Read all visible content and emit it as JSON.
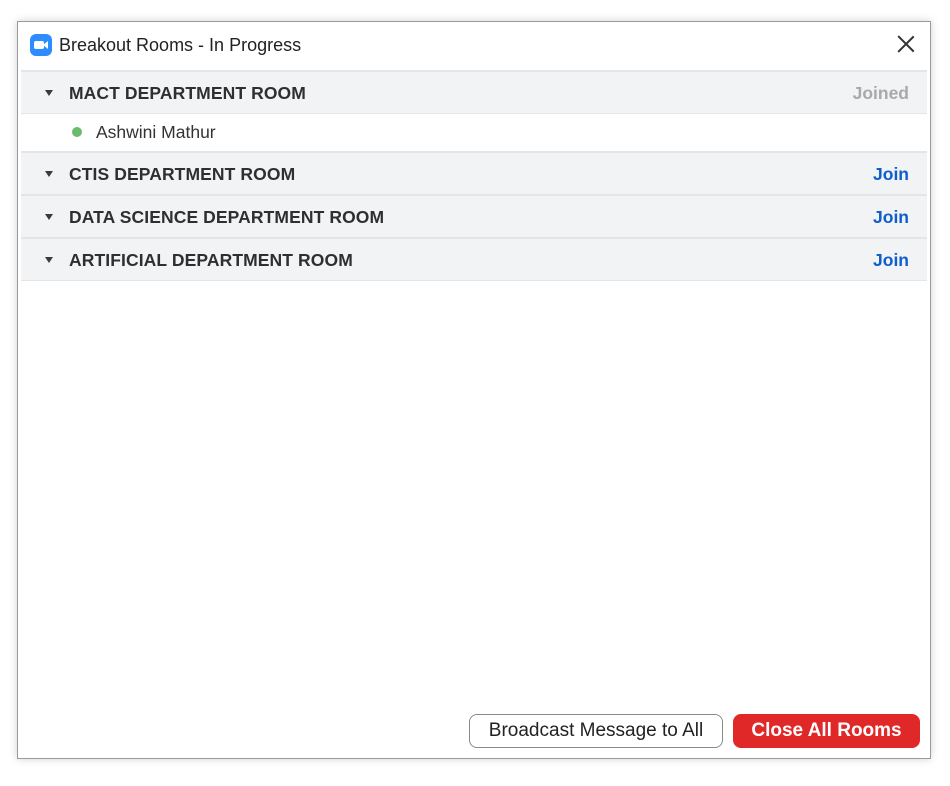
{
  "window": {
    "title": "Breakout Rooms - In Progress"
  },
  "rooms": [
    {
      "name": "MACT DEPARTMENT ROOM",
      "action": "Joined",
      "participants": [
        "Ashwini Mathur"
      ]
    },
    {
      "name": "CTIS DEPARTMENT ROOM",
      "action": "Join",
      "participants": []
    },
    {
      "name": "DATA SCIENCE DEPARTMENT ROOM",
      "action": "Join",
      "participants": []
    },
    {
      "name": "ARTIFICIAL DEPARTMENT ROOM",
      "action": "Join",
      "participants": []
    }
  ],
  "footer": {
    "broadcast_label": "Broadcast Message to All",
    "close_all_label": "Close All Rooms"
  },
  "colors": {
    "accent_blue": "#0e5fcd",
    "close_red": "#e02828",
    "online_green": "#6cba6c",
    "joined_gray": "#a9a9a9"
  },
  "icons": {
    "app": "zoom-camera-icon",
    "close": "close-icon",
    "caret": "caret-down-icon",
    "status": "online-status-dot-icon"
  }
}
